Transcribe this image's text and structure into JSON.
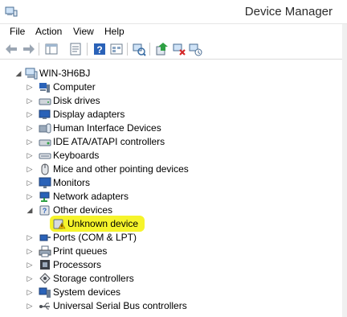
{
  "window": {
    "title": "Device Manager",
    "icon": "device-manager-icon"
  },
  "menu": {
    "items": [
      "File",
      "Action",
      "View",
      "Help"
    ]
  },
  "toolbar": {
    "buttons": [
      "back-arrow-icon",
      "forward-arrow-icon",
      "show-hide-tree-icon",
      "properties-icon",
      "help-icon",
      "view-resources-icon",
      "scan-hardware-icon",
      "update-driver-icon",
      "uninstall-device-icon",
      "disable-device-icon"
    ]
  },
  "tree": {
    "root": {
      "label": "WIN-3H6BJ",
      "icon": "computer-icon",
      "expanded": true
    },
    "items": [
      {
        "label": "Computer",
        "icon": "computer-icon"
      },
      {
        "label": "Disk drives",
        "icon": "disk-drive-icon"
      },
      {
        "label": "Display adapters",
        "icon": "display-adapter-icon"
      },
      {
        "label": "Human Interface Devices",
        "icon": "hid-icon"
      },
      {
        "label": "IDE ATA/ATAPI controllers",
        "icon": "ide-controller-icon"
      },
      {
        "label": "Keyboards",
        "icon": "keyboard-icon"
      },
      {
        "label": "Mice and other pointing devices",
        "icon": "mouse-icon"
      },
      {
        "label": "Monitors",
        "icon": "monitor-icon"
      },
      {
        "label": "Network adapters",
        "icon": "network-adapter-icon"
      },
      {
        "label": "Other devices",
        "icon": "other-devices-icon",
        "expanded": true
      },
      {
        "label": "Unknown device",
        "icon": "unknown-device-warning-icon",
        "child": true,
        "highlighted": true
      },
      {
        "label": "Ports (COM & LPT)",
        "icon": "port-icon"
      },
      {
        "label": "Print queues",
        "icon": "printer-icon"
      },
      {
        "label": "Processors",
        "icon": "processor-icon"
      },
      {
        "label": "Storage controllers",
        "icon": "storage-controller-icon"
      },
      {
        "label": "System devices",
        "icon": "system-devices-icon"
      },
      {
        "label": "Universal Serial Bus controllers",
        "icon": "usb-icon"
      }
    ]
  },
  "colors": {
    "highlight": "#f6f42b",
    "accent": "#1f5fbf",
    "warning": "#e8b400"
  }
}
